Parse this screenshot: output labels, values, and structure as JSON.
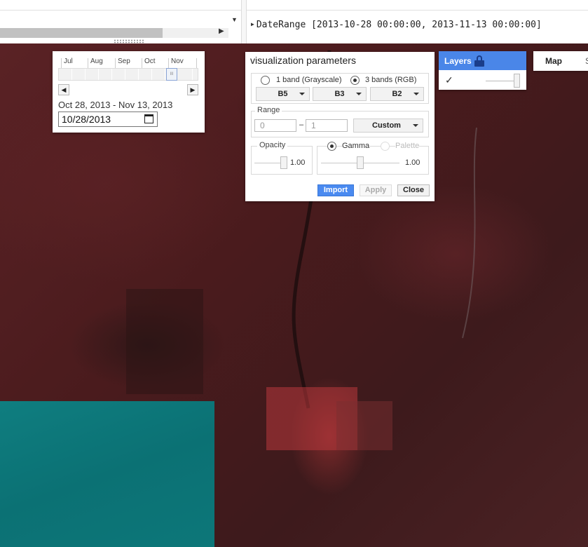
{
  "console": {
    "expand_icon": "triangle-right-icon",
    "output": "DateRange [2013-10-28 00:00:00, 2013-11-13 00:00:00]"
  },
  "date_slider": {
    "months": [
      "Jul",
      "Aug",
      "Sep",
      "Oct",
      "Nov"
    ],
    "range_text": "Oct 28, 2013 - Nov 13, 2013",
    "date_value": "10/28/2013",
    "prev_icon": "triangle-left-icon",
    "next_icon": "triangle-right-icon",
    "handle_glyph": "III"
  },
  "vis_params": {
    "title": "visualization parameters",
    "mode_grayscale": "1 band (Grayscale)",
    "mode_rgb": "3 bands (RGB)",
    "selected_mode": "rgb",
    "bands": [
      "B5",
      "B3",
      "B2"
    ],
    "range_label": "Range",
    "range_min": "0",
    "range_dash": "–",
    "range_max": "1",
    "range_mode": "Custom",
    "opacity_label": "Opacity",
    "opacity_value": "1.00",
    "gamma_label": "Gamma",
    "palette_label": "Palette",
    "gamma_value": "1.00",
    "import_label": "Import",
    "apply_label": "Apply",
    "close_label": "Close"
  },
  "layers": {
    "title": "Layers",
    "layer_checked": true,
    "check_glyph": "✓",
    "opacity": 1.0
  },
  "map_type": {
    "map_label": "Map",
    "satellite_label_partial": "S"
  },
  "colors": {
    "accent": "#4a86e8",
    "import": "#4a8af0",
    "map_bg": "#4a1b1d",
    "teal": "#0b7174"
  }
}
